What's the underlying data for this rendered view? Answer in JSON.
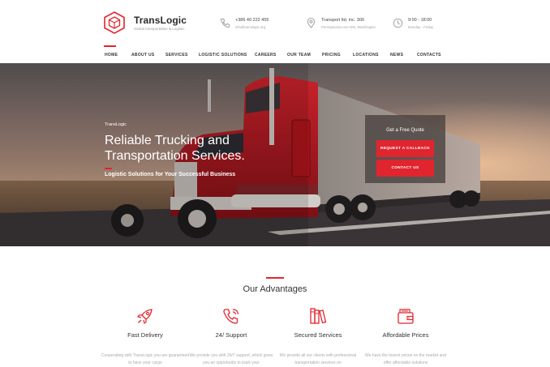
{
  "brand": {
    "name": "TransLogic",
    "tagline": "Global transportation & Logistic",
    "accent_color": "#e0252f"
  },
  "contacts": {
    "phone": {
      "icon": "phone-icon",
      "line1": "+386 40 222 455",
      "line2": "info@translogic.org"
    },
    "address": {
      "icon": "location-pin-icon",
      "line1": "Transport ltd, inc. 300",
      "line2": "Pennsylvania Ave NW, Washington"
    },
    "hours": {
      "icon": "clock-icon",
      "line1": "9:00 - 18:00",
      "line2": "Monday - Friday"
    }
  },
  "nav": {
    "items": [
      "HOME",
      "ABOUT US",
      "SERVICES",
      "LOGISTIC SOLUTIONS",
      "CAREERS",
      "OUR TEAM",
      "PRICING",
      "LOCATIONS",
      "NEWS",
      "CONTACTS"
    ],
    "active": "HOME"
  },
  "hero": {
    "brand": "TransLogic",
    "title": "Reliable Trucking and Transportation Services.",
    "subtitle": "Logistic Solutions for Your Successful Business",
    "quote": {
      "title": "Get a Free Quote",
      "request_label": "REQUEST A CALLBACK",
      "contact_label": "CONTACT US"
    }
  },
  "advantages": {
    "title": "Our Advantages",
    "items": [
      {
        "icon": "rocket-icon",
        "name": "Fast Delivery",
        "text": "Cooperating with TransLogic you are guaranteed to have your cargo"
      },
      {
        "icon": "phone-support-icon",
        "name": "24/ Support",
        "text": "We provide you with 24/7 support, which gives you an opportunity to track your"
      },
      {
        "icon": "books-icon",
        "name": "Secured Services",
        "text": "We provide all our clients with professional transportation services on"
      },
      {
        "icon": "wallet-icon",
        "name": "Affordable Prices",
        "text": "We have the lowest prices on the market and offer affordable solutions"
      }
    ]
  }
}
